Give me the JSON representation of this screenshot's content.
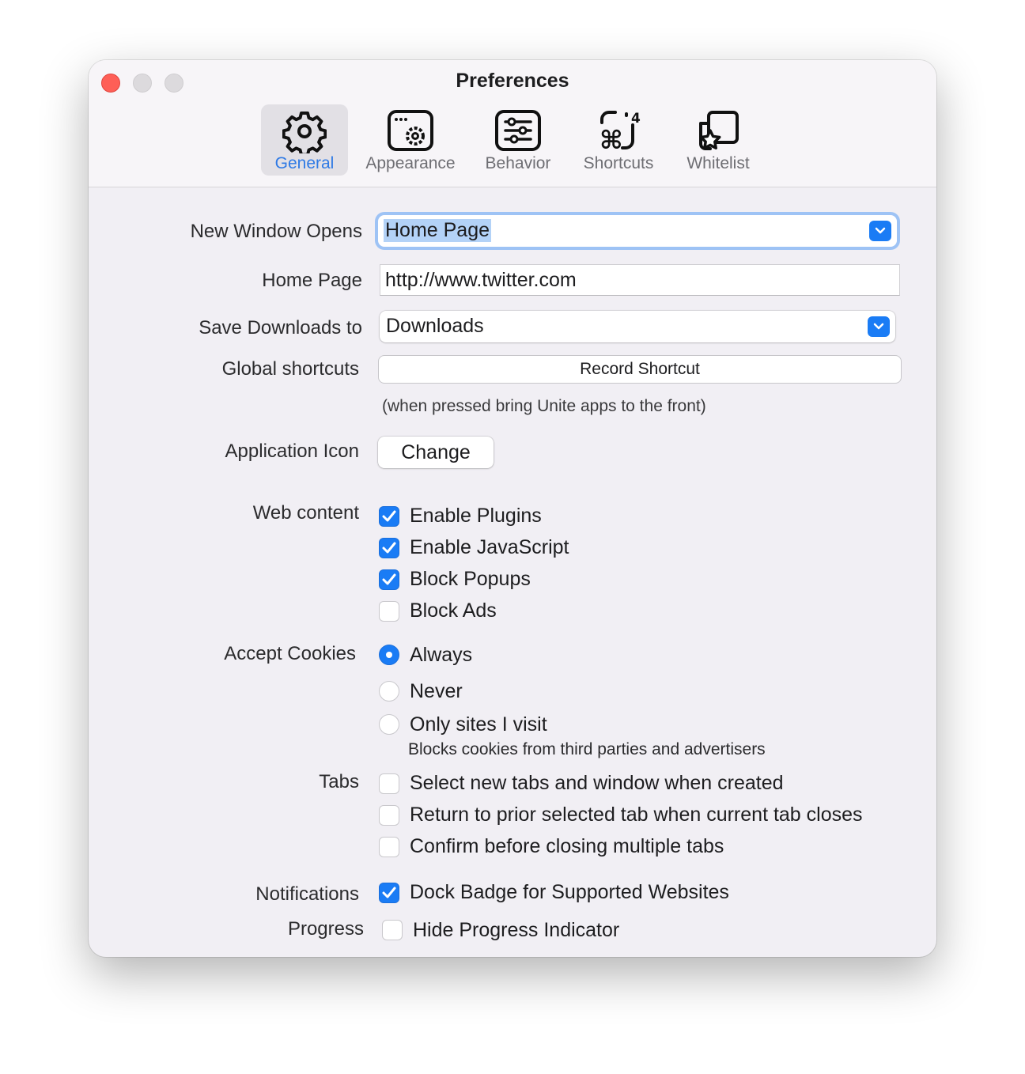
{
  "window": {
    "title": "Preferences"
  },
  "toolbar": [
    {
      "label": "General",
      "icon": "gear-icon",
      "active": true
    },
    {
      "label": "Appearance",
      "icon": "appearance-icon",
      "active": false
    },
    {
      "label": "Behavior",
      "icon": "sliders-icon",
      "active": false
    },
    {
      "label": "Shortcuts",
      "icon": "command-key-icon",
      "active": false
    },
    {
      "label": "Whitelist",
      "icon": "star-window-icon",
      "active": false
    }
  ],
  "general": {
    "new_window_opens": {
      "label": "New Window Opens",
      "value": "Home Page"
    },
    "home_page": {
      "label": "Home Page",
      "value": "http://www.twitter.com"
    },
    "save_downloads": {
      "label": "Save Downloads to",
      "value": "Downloads"
    },
    "global_shortcuts": {
      "label": "Global shortcuts",
      "button": "Record Shortcut",
      "note": "(when pressed bring Unite apps to the front)"
    },
    "application_icon": {
      "label": "Application Icon",
      "button": "Change"
    },
    "web_content": {
      "label": "Web content",
      "options": [
        {
          "label": "Enable Plugins",
          "checked": true
        },
        {
          "label": "Enable JavaScript",
          "checked": true
        },
        {
          "label": "Block Popups",
          "checked": true
        },
        {
          "label": "Block Ads",
          "checked": false
        }
      ]
    },
    "accept_cookies": {
      "label": "Accept Cookies",
      "options": [
        {
          "label": "Always",
          "selected": true
        },
        {
          "label": "Never",
          "selected": false
        },
        {
          "label": "Only sites I visit",
          "selected": false
        }
      ],
      "note": "Blocks cookies from third parties and advertisers"
    },
    "tabs": {
      "label": "Tabs",
      "options": [
        {
          "label": "Select new tabs and window when created",
          "checked": false
        },
        {
          "label": "Return to prior selected tab when current tab closes",
          "checked": false
        },
        {
          "label": "Confirm before closing multiple tabs",
          "checked": false
        }
      ]
    },
    "notifications": {
      "label": "Notifications",
      "option": "Dock Badge for Supported Websites",
      "checked": true
    },
    "progress": {
      "label": "Progress",
      "option": "Hide Progress Indicator",
      "checked": false
    }
  },
  "colors": {
    "accent": "#1a7cf5",
    "close": "#fe5f57",
    "window_bg": "#f1eff4"
  }
}
